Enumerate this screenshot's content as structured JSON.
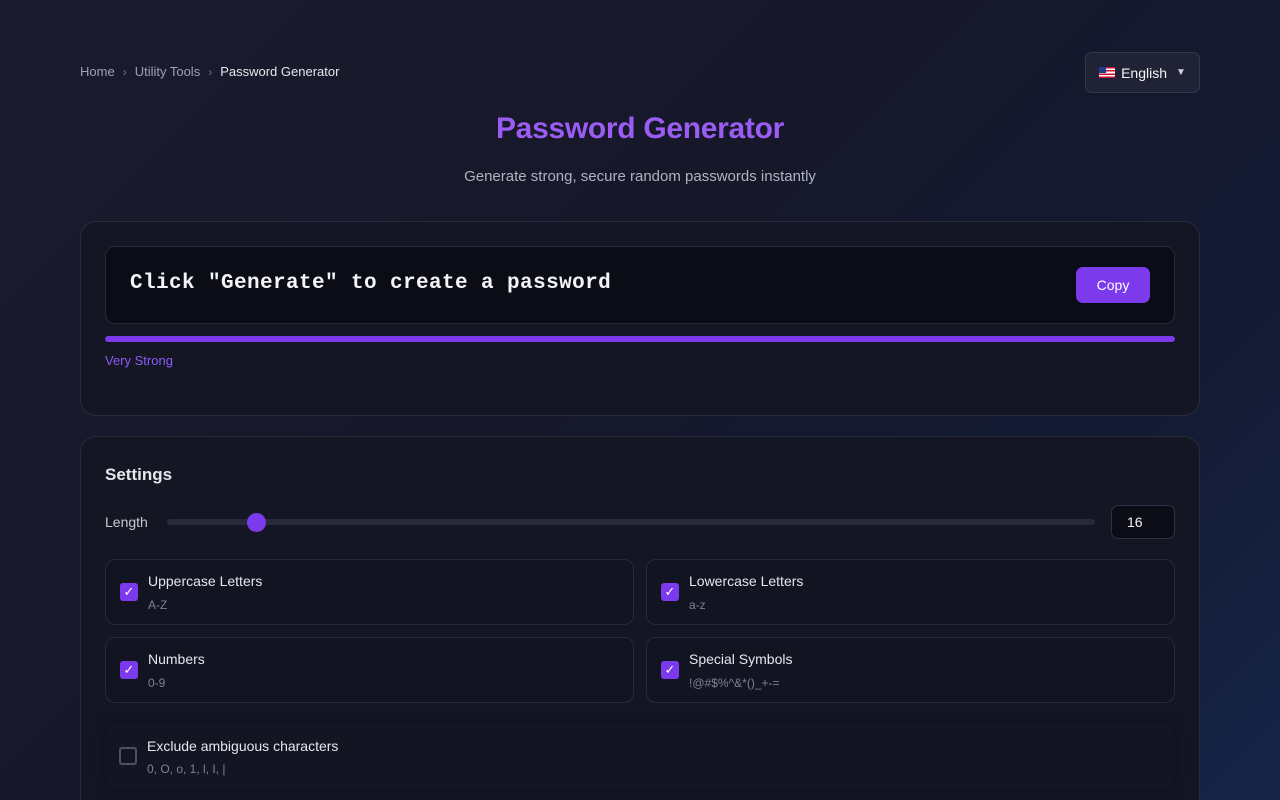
{
  "breadcrumb": {
    "home": "Home",
    "separator": "›",
    "category": "Utility Tools",
    "current": "Password Generator"
  },
  "language": {
    "icon": "us-flag-icon",
    "label": "English",
    "caret": "▼"
  },
  "header": {
    "title": "Password Generator",
    "subtitle": "Generate strong, secure random passwords instantly"
  },
  "output": {
    "password_text": "Click \"Generate\" to create a password",
    "copy_label": "Copy",
    "strength_label": "Very Strong",
    "strength_level": 1.0
  },
  "settings": {
    "title": "Settings",
    "length_label": "Length",
    "length_value": "16",
    "length_min": 4,
    "length_max": 128,
    "options": [
      {
        "name": "Uppercase Letters",
        "desc": "A-Z",
        "checked": true
      },
      {
        "name": "Lowercase Letters",
        "desc": "a-z",
        "checked": true
      },
      {
        "name": "Numbers",
        "desc": "0-9",
        "checked": true
      },
      {
        "name": "Special Symbols",
        "desc": "!@#$%^&*()_+-=",
        "checked": true
      }
    ],
    "exclude": {
      "name": "Exclude ambiguous characters",
      "desc": "0, O, o, 1, l, I, |",
      "checked": false
    }
  },
  "colors": {
    "accent": "#7c3aed",
    "title": "#9b5cf3",
    "background": "#1a1b2e"
  }
}
